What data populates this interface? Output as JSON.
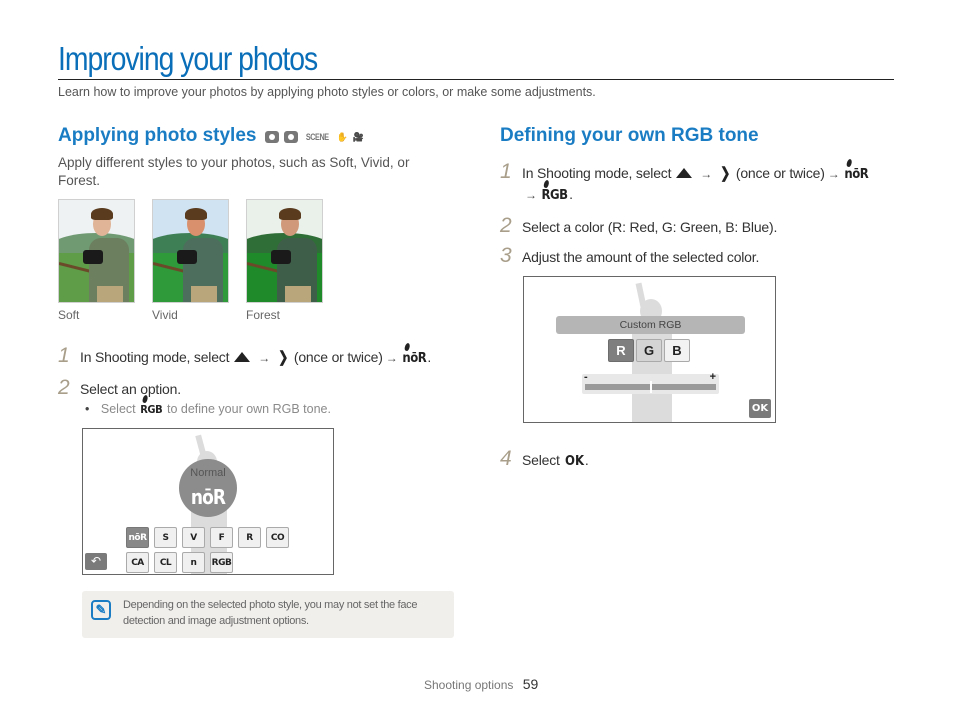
{
  "header": {
    "title": "Improving your photos",
    "intro": "Learn how to improve your photos by applying photo styles or colors, or make some adjustments."
  },
  "left_section": {
    "title": "Applying photo styles",
    "mode_icons": [
      "camera-icon",
      "smart-camera-icon",
      "scene-icon",
      "dual-is-icon",
      "movie-icon"
    ],
    "scene_label": "SCENE",
    "description": "Apply different styles to your photos, such as Soft, Vivid, or Forest.",
    "photos": [
      {
        "caption": "Soft"
      },
      {
        "caption": "Vivid"
      },
      {
        "caption": "Forest"
      }
    ],
    "steps": [
      {
        "num": "1",
        "text_before": "In Shooting mode, select",
        "arrow": "→",
        "text_mid": "(once or twice)",
        "glyph": "nōR",
        "end": "."
      },
      {
        "num": "2",
        "text": "Select an option."
      }
    ],
    "sub_bullet": {
      "bullet": "•",
      "before": "Select",
      "glyph": "RGB",
      "after": "to define your own RGB tone."
    },
    "screen": {
      "label": "Normal",
      "big_glyph": "nōR",
      "styles": [
        "nōR",
        "S",
        "V",
        "F",
        "R",
        "CO",
        "CA",
        "CL",
        "n",
        "RGB"
      ],
      "active_index": 0,
      "back_symbol": "↶"
    },
    "note": {
      "icon": "note-icon",
      "text": "Depending on the selected photo style, you may not set the face detection and image adjustment options."
    }
  },
  "right_section": {
    "title": "Defining your own RGB tone",
    "steps": [
      {
        "num": "1",
        "text_before": "In Shooting mode, select",
        "arrow": "→",
        "text_mid": "(once or twice)",
        "glyph": "nōR",
        "line2_glyph": "RGB",
        "end": "."
      },
      {
        "num": "2",
        "text": "Select a color (R: Red, G: Green, B: Blue)."
      },
      {
        "num": "3",
        "text": "Adjust the amount of the selected color."
      },
      {
        "num": "4",
        "text": "Select",
        "glyph": "OK",
        "end": "."
      }
    ],
    "screen": {
      "title": "Custom RGB",
      "buttons": [
        "R",
        "G",
        "B"
      ],
      "selected": "R",
      "slider_minus": "-",
      "slider_plus": "+",
      "slider_value": 0.5,
      "ok_label": "OK"
    }
  },
  "footer": {
    "section": "Shooting options",
    "page": "59"
  }
}
